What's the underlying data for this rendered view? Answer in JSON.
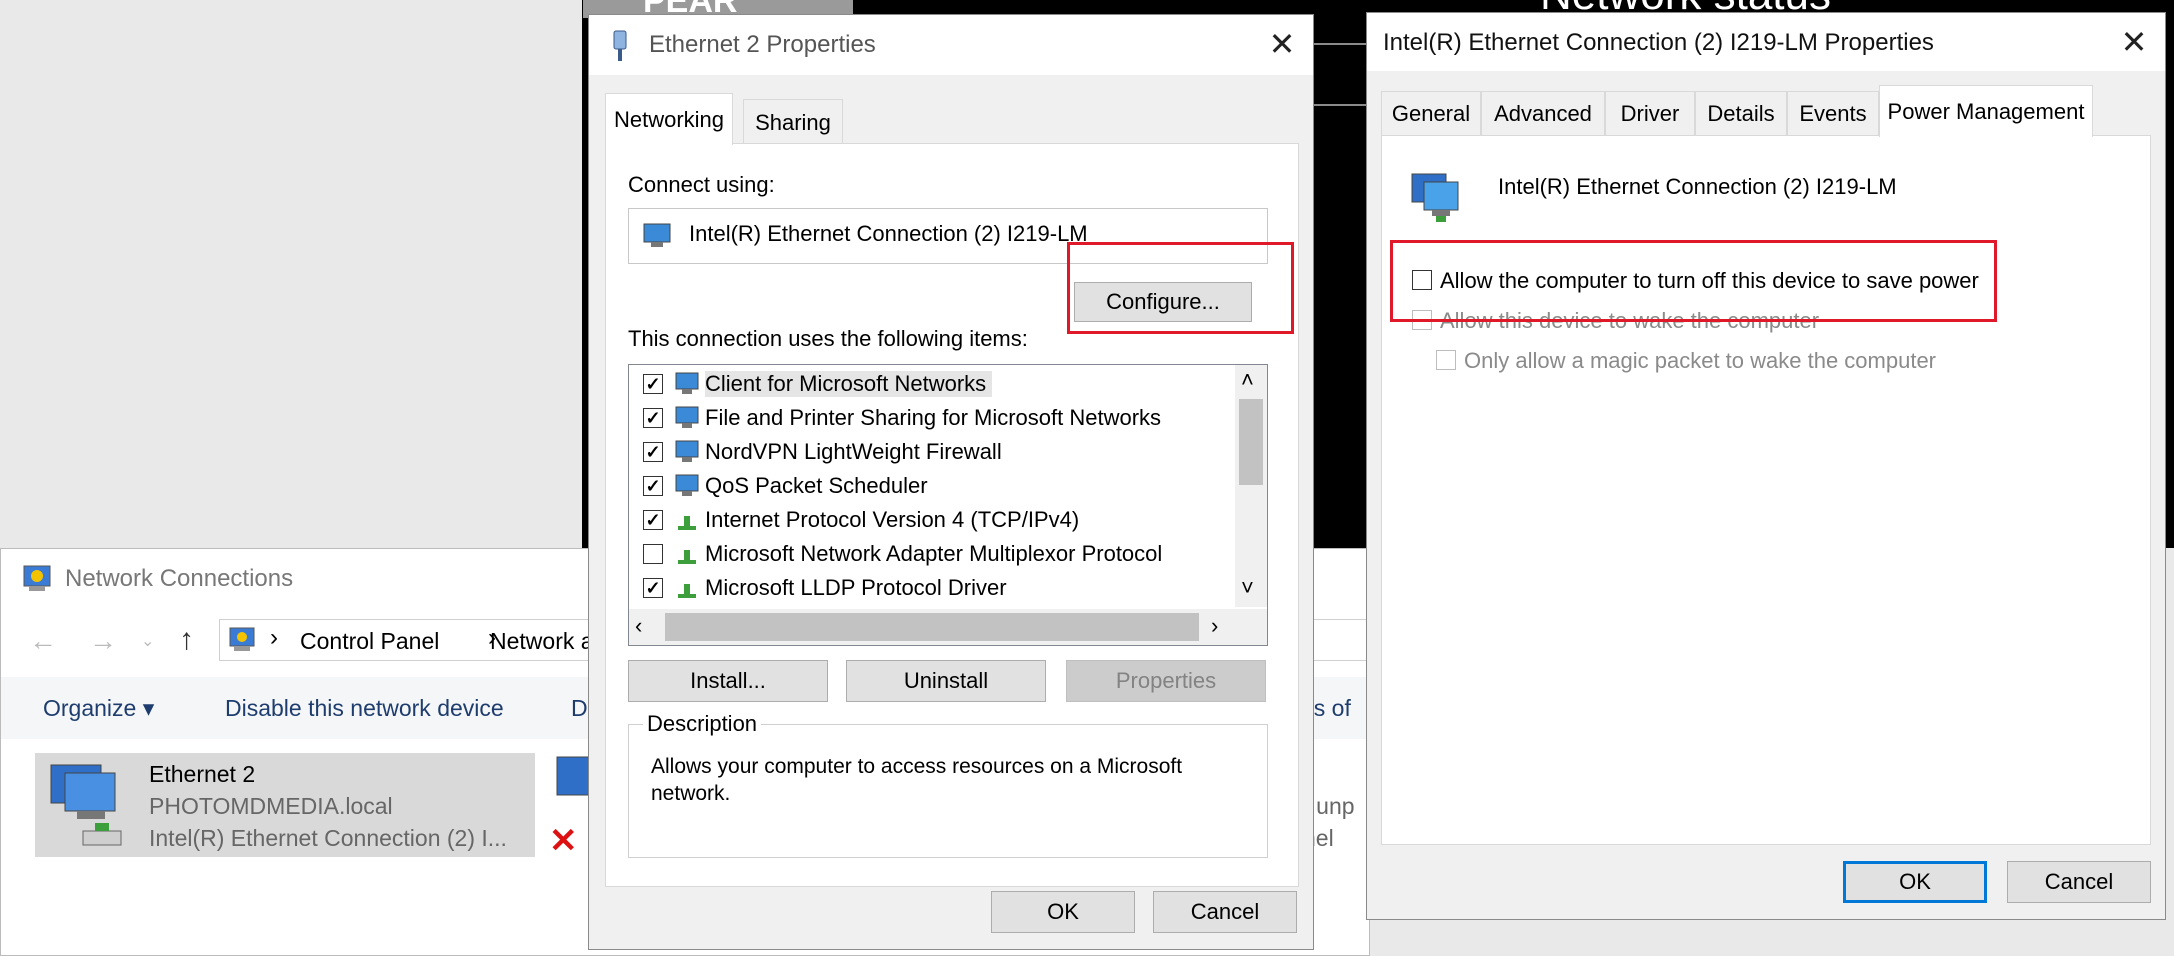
{
  "network_connections": {
    "title": "Network Connections",
    "nav": {
      "breadcrumb_1": "Control Panel",
      "breadcrumb_2": "Network a"
    },
    "toolbar": {
      "organize": "Organize ▾",
      "disable": "Disable this network device",
      "di": "Di",
      "status_of": "us of"
    },
    "item1": {
      "name": "Ethernet 2",
      "domain": "PHOTOMDMEDIA.local",
      "adapter": "Intel(R) Ethernet Connection (2) I..."
    },
    "item2_fragments": {
      "line1": "e unp",
      "line2": "nel"
    }
  },
  "background": {
    "big_text": "Network status",
    "logo_text": "PEAR"
  },
  "eth_props": {
    "title": "Ethernet 2 Properties",
    "tabs": {
      "networking": "Networking",
      "sharing": "Sharing"
    },
    "connect_using": "Connect using:",
    "adapter_name": "Intel(R) Ethernet Connection (2) I219-LM",
    "configure": "Configure...",
    "items_label": "This connection uses the following items:",
    "items": [
      {
        "label": "Client for Microsoft Networks",
        "checked": true
      },
      {
        "label": "File and Printer Sharing for Microsoft Networks",
        "checked": true
      },
      {
        "label": "NordVPN LightWeight Firewall",
        "checked": true
      },
      {
        "label": "QoS Packet Scheduler",
        "checked": true
      },
      {
        "label": "Internet Protocol Version 4 (TCP/IPv4)",
        "checked": true
      },
      {
        "label": "Microsoft Network Adapter Multiplexor Protocol",
        "checked": false
      },
      {
        "label": "Microsoft LLDP Protocol Driver",
        "checked": true
      }
    ],
    "buttons": {
      "install": "Install...",
      "uninstall": "Uninstall",
      "properties": "Properties"
    },
    "description_label": "Description",
    "description_text": "Allows your computer to access resources on a Microsoft network.",
    "ok": "OK",
    "cancel": "Cancel"
  },
  "intel_props": {
    "title": "Intel(R) Ethernet Connection (2) I219-LM Properties",
    "tabs": {
      "general": "General",
      "advanced": "Advanced",
      "driver": "Driver",
      "details": "Details",
      "events": "Events",
      "power": "Power Management"
    },
    "device_name": "Intel(R) Ethernet Connection (2) I219-LM",
    "opt1": "Allow the computer to turn off this device to save power",
    "opt2": "Allow this device to wake the computer",
    "opt3": "Only allow a magic packet to wake the computer",
    "ok": "OK",
    "cancel": "Cancel"
  },
  "colors": {
    "highlight_box": "#e0192a",
    "accent": "#0078d7"
  }
}
